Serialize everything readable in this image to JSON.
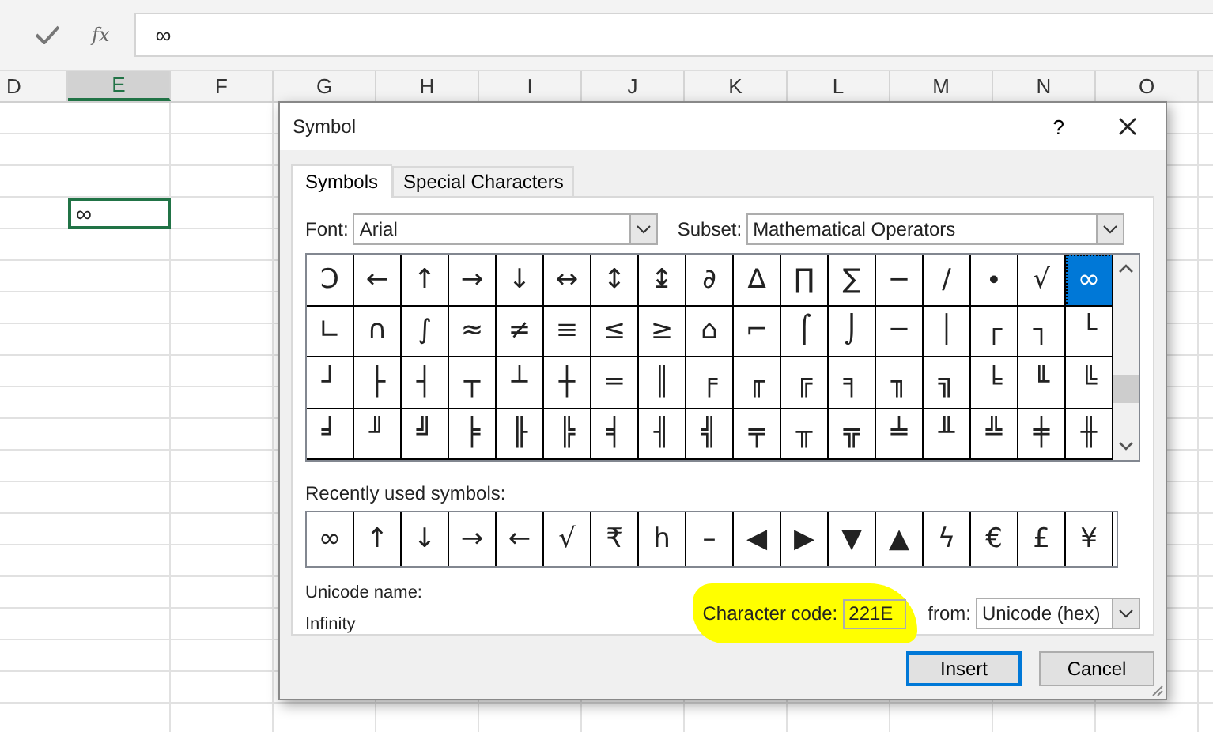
{
  "formula_bar": {
    "function_label": "fx",
    "value": "∞"
  },
  "columns": [
    {
      "label": "D",
      "selected": false
    },
    {
      "label": "E",
      "selected": true
    },
    {
      "label": "F",
      "selected": false
    },
    {
      "label": "G",
      "selected": false
    },
    {
      "label": "H",
      "selected": false
    },
    {
      "label": "I",
      "selected": false
    },
    {
      "label": "J",
      "selected": false
    },
    {
      "label": "K",
      "selected": false
    },
    {
      "label": "L",
      "selected": false
    },
    {
      "label": "M",
      "selected": false
    },
    {
      "label": "N",
      "selected": false
    },
    {
      "label": "O",
      "selected": false
    }
  ],
  "active_cell": {
    "value": "∞"
  },
  "dialog": {
    "title": "Symbol",
    "help": "?",
    "tabs": [
      {
        "label": "Symbols",
        "selected": true
      },
      {
        "label": "Special Characters",
        "selected": false
      }
    ],
    "font": {
      "label": "Font:",
      "value": "Arial"
    },
    "subset": {
      "label": "Subset:",
      "value": "Mathematical Operators"
    },
    "symbols": [
      {
        "char": "Ↄ",
        "selected": false
      },
      {
        "char": "←",
        "selected": false
      },
      {
        "char": "↑",
        "selected": false
      },
      {
        "char": "→",
        "selected": false
      },
      {
        "char": "↓",
        "selected": false
      },
      {
        "char": "↔",
        "selected": false
      },
      {
        "char": "↕",
        "selected": false
      },
      {
        "char": "↨",
        "selected": false
      },
      {
        "char": "∂",
        "selected": false
      },
      {
        "char": "∆",
        "selected": false
      },
      {
        "char": "∏",
        "selected": false
      },
      {
        "char": "∑",
        "selected": false
      },
      {
        "char": "−",
        "selected": false
      },
      {
        "char": "∕",
        "selected": false
      },
      {
        "char": "∙",
        "selected": false
      },
      {
        "char": "√",
        "selected": false
      },
      {
        "char": "∞",
        "selected": true
      },
      {
        "char": "∟",
        "selected": false
      },
      {
        "char": "∩",
        "selected": false
      },
      {
        "char": "∫",
        "selected": false
      },
      {
        "char": "≈",
        "selected": false
      },
      {
        "char": "≠",
        "selected": false
      },
      {
        "char": "≡",
        "selected": false
      },
      {
        "char": "≤",
        "selected": false
      },
      {
        "char": "≥",
        "selected": false
      },
      {
        "char": "⌂",
        "selected": false
      },
      {
        "char": "⌐",
        "selected": false
      },
      {
        "char": "⌠",
        "selected": false
      },
      {
        "char": "⌡",
        "selected": false
      },
      {
        "char": "─",
        "selected": false
      },
      {
        "char": "│",
        "selected": false
      },
      {
        "char": "┌",
        "selected": false
      },
      {
        "char": "┐",
        "selected": false
      },
      {
        "char": "└",
        "selected": false
      },
      {
        "char": "┘",
        "selected": false
      },
      {
        "char": "├",
        "selected": false
      },
      {
        "char": "┤",
        "selected": false
      },
      {
        "char": "┬",
        "selected": false
      },
      {
        "char": "┴",
        "selected": false
      },
      {
        "char": "┼",
        "selected": false
      },
      {
        "char": "═",
        "selected": false
      },
      {
        "char": "║",
        "selected": false
      },
      {
        "char": "╒",
        "selected": false
      },
      {
        "char": "╓",
        "selected": false
      },
      {
        "char": "╔",
        "selected": false
      },
      {
        "char": "╕",
        "selected": false
      },
      {
        "char": "╖",
        "selected": false
      },
      {
        "char": "╗",
        "selected": false
      },
      {
        "char": "╘",
        "selected": false
      },
      {
        "char": "╙",
        "selected": false
      },
      {
        "char": "╚",
        "selected": false
      },
      {
        "char": "╛",
        "selected": false
      },
      {
        "char": "╜",
        "selected": false
      },
      {
        "char": "╝",
        "selected": false
      },
      {
        "char": "╞",
        "selected": false
      },
      {
        "char": "╟",
        "selected": false
      },
      {
        "char": "╠",
        "selected": false
      },
      {
        "char": "╡",
        "selected": false
      },
      {
        "char": "╢",
        "selected": false
      },
      {
        "char": "╣",
        "selected": false
      },
      {
        "char": "╤",
        "selected": false
      },
      {
        "char": "╥",
        "selected": false
      },
      {
        "char": "╦",
        "selected": false
      },
      {
        "char": "╧",
        "selected": false
      },
      {
        "char": "╨",
        "selected": false
      },
      {
        "char": "╩",
        "selected": false
      },
      {
        "char": "╪",
        "selected": false
      },
      {
        "char": "╫",
        "selected": false
      }
    ],
    "recent_label": "Recently used symbols:",
    "recent": [
      "∞",
      "↑",
      "↓",
      "→",
      "←",
      "√",
      "₹",
      "h",
      "–",
      "◀",
      "▶",
      "▼",
      "▲",
      "ϟ",
      "€",
      "£",
      "¥"
    ],
    "unicode_name_label": "Unicode name:",
    "unicode_name": "Infinity",
    "character_code": {
      "label": "Character code:",
      "value": "221E",
      "highlighted": true
    },
    "from": {
      "label": "from:",
      "value": "Unicode (hex)"
    },
    "buttons": [
      {
        "label": "Insert",
        "default": true
      },
      {
        "label": "Cancel",
        "default": false
      }
    ]
  }
}
